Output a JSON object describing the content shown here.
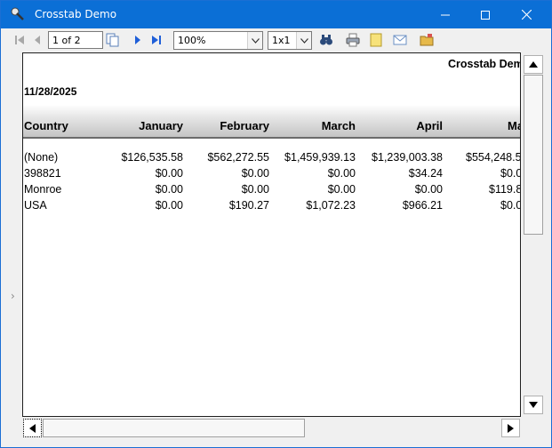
{
  "window": {
    "title": "Crosstab Demo"
  },
  "toolbar": {
    "page_indicator": "1 of 2",
    "zoom": "100%",
    "pages_per_view": "1x1"
  },
  "report": {
    "title": "Crosstab Dem",
    "date": "11/28/2025",
    "columns": [
      "Country",
      "January",
      "February",
      "March",
      "April",
      "Ma"
    ],
    "rows": [
      {
        "country": "(None)",
        "values": [
          "$126,535.58",
          "$562,272.55",
          "$1,459,939.13",
          "$1,239,003.38",
          "$554,248.5"
        ]
      },
      {
        "country": "398821",
        "values": [
          "$0.00",
          "$0.00",
          "$0.00",
          "$34.24",
          "$0.0"
        ]
      },
      {
        "country": "Monroe",
        "values": [
          "$0.00",
          "$0.00",
          "$0.00",
          "$0.00",
          "$119.8"
        ]
      },
      {
        "country": "USA",
        "values": [
          "$0.00",
          "$190.27",
          "$1,072.23",
          "$966.21",
          "$0.0"
        ]
      }
    ]
  },
  "colors": {
    "titlebar": "#0b6fd6",
    "nav_blue": "#1f5fd8"
  }
}
